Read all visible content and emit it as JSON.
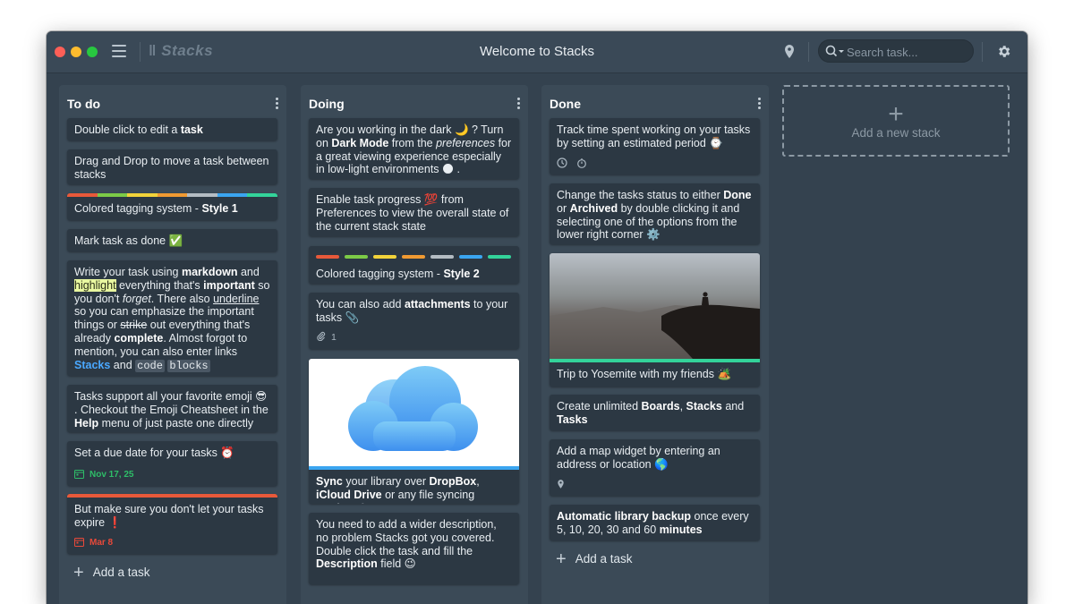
{
  "window": {
    "title": "Welcome to Stacks",
    "logo": "Stacks",
    "search_placeholder": "Search task..."
  },
  "colors": {
    "tags": [
      "#e8593a",
      "#7ccb47",
      "#f2d33a",
      "#f09a32",
      "#b4bcc3",
      "#3aa5f0",
      "#33d39a"
    ],
    "background": "#34424f",
    "card": "#2c3843"
  },
  "stacks": [
    {
      "title": "To do",
      "add_label": "Add a task",
      "cards": {
        "c1": "Double click to edit a <b>task</b>",
        "c2": "Drag and Drop to move a task between stacks",
        "c3": "Colored tagging system - <b>Style 1</b>",
        "c4": "Mark task as done ✅",
        "c5": "Write your task using <b>markdown</b> and <span class=\"hl\">highlight</span> everything that's <b>important</b> so you don't <i>forget</i>. There also <u>underline</u> so you can emphasize the important things or <s>strike</s> out everything that's already <b>complete</b>. Almost forgot to mention, you can also enter links <span class=\"link\">Stacks</span> and <span class=\"code\">code</span> <span class=\"code\">blocks</span>",
        "c6": "Tasks support all your favorite emoji 😎 . Checkout the Emoji Cheatsheet in the <b>Help</b> menu of just paste one directly",
        "c7": "Set a due date for your tasks ⏰",
        "c7_date": "Nov 17, 25",
        "c8": "But make sure you don't let your tasks expire ❗",
        "c8_date": "Mar 8"
      }
    },
    {
      "title": "Doing",
      "cards": {
        "c1": "Are you working in the dark 🌙 ? Turn on <b>Dark Mode</b> from the <i>preferences</i> for a great viewing experience especially in low-light environments 🌑 .",
        "c2": "Enable task progress 💯 from Preferences to view the overall state of the current stack state",
        "c3": "Colored tagging system - <b>Style 2</b>",
        "c4": "You can also add <b>attachments</b> to your tasks 📎",
        "c4_count": "1",
        "c5": "<b>Sync</b> your library over <b>DropBox</b>, <b>iCloud Drive</b> or any file syncing service ☁️",
        "c6": "You need to add a wider description, no problem Stacks got you covered. Double click the task and fill the <b>Description</b> field 😉"
      }
    },
    {
      "title": "Done",
      "add_label": "Add a task",
      "cards": {
        "c1": "Track time spent working on your tasks by setting an estimated period ⌚",
        "c2": "Change the tasks status to either <b>Done</b> or <b>Archived</b> by double clicking it and selecting one of the options from the lower right corner ⚙️",
        "c3": "Trip to Yosemite with my friends 🏕️",
        "c4": "Create unlimited <b>Boards</b>, <b>Stacks</b> and <b>Tasks</b>",
        "c5": "Add a map widget by entering an address or location 🌎",
        "c6": "<b>Automatic library backup</b> once every 5, 10, 20, 30 and 60 <b>minutes</b>"
      }
    }
  ],
  "new_stack_label": "Add a new stack"
}
